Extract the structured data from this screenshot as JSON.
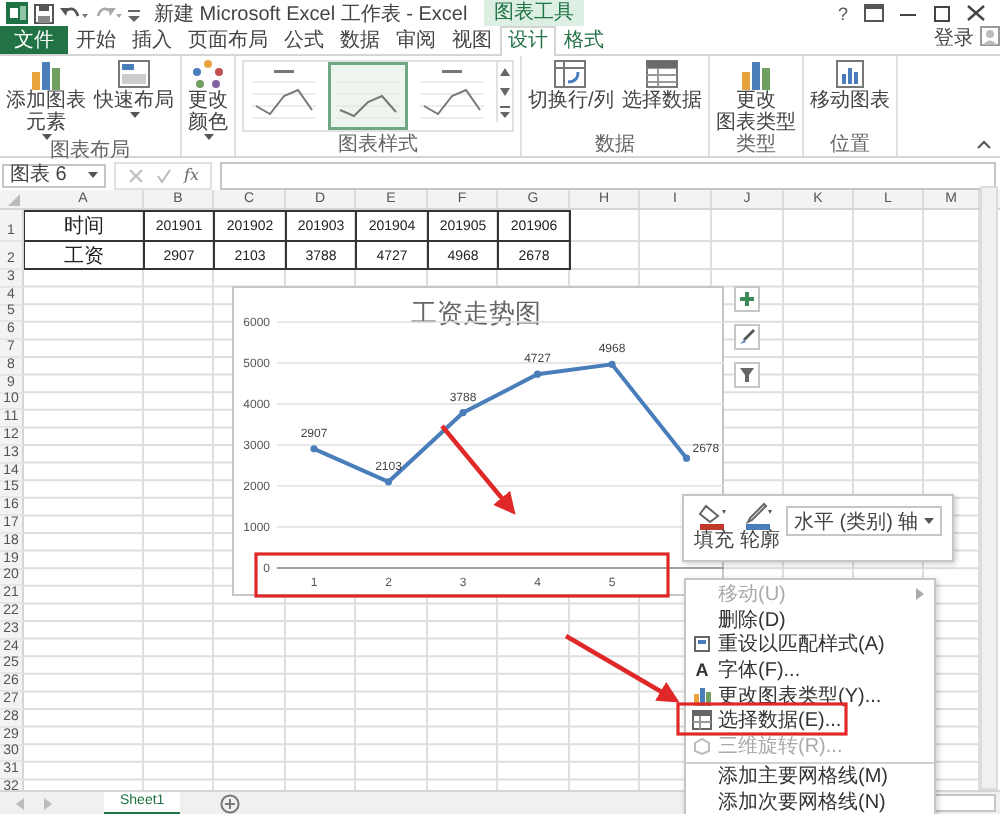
{
  "window": {
    "title": "新建 Microsoft Excel 工作表 - Excel",
    "context_tab_group": "图表工具",
    "help": "?",
    "sign_in": "登录"
  },
  "tabs": [
    {
      "label": "文件",
      "kind": "file",
      "selected": false
    },
    {
      "label": "开始",
      "kind": "tab",
      "selected": false
    },
    {
      "label": "插入",
      "kind": "tab",
      "selected": false
    },
    {
      "label": "页面布局",
      "kind": "tab",
      "selected": false
    },
    {
      "label": "公式",
      "kind": "tab",
      "selected": false
    },
    {
      "label": "数据",
      "kind": "tab",
      "selected": false
    },
    {
      "label": "审阅",
      "kind": "tab",
      "selected": false
    },
    {
      "label": "视图",
      "kind": "tab",
      "selected": false
    },
    {
      "label": "设计",
      "kind": "context",
      "selected": true
    },
    {
      "label": "格式",
      "kind": "context",
      "selected": false
    }
  ],
  "ribbon": {
    "groups": [
      {
        "label": "图表布局",
        "kind": "buttons",
        "buttons": [
          {
            "lines": [
              "添加图表",
              "元素"
            ],
            "dropdown": true
          },
          {
            "lines": [
              "快速布局"
            ],
            "dropdown": true
          }
        ]
      },
      {
        "kind": "buttons",
        "buttons": [
          {
            "lines": [
              "更改",
              "颜色"
            ],
            "dropdown": true
          }
        ]
      },
      {
        "label": "图表样式",
        "kind": "gallery",
        "styles": [
          {
            "selected": false
          },
          {
            "selected": true
          },
          {
            "selected": false
          }
        ]
      },
      {
        "label": "数据",
        "kind": "buttons",
        "buttons": [
          {
            "lines": [
              "切换行/列"
            ],
            "dropdown": false
          },
          {
            "lines": [
              "选择数据"
            ],
            "dropdown": false
          }
        ]
      },
      {
        "label": "类型",
        "kind": "buttons",
        "buttons": [
          {
            "lines": [
              "更改",
              "图表类型"
            ],
            "dropdown": false
          }
        ]
      },
      {
        "label": "位置",
        "kind": "buttons",
        "buttons": [
          {
            "lines": [
              "移动图表"
            ],
            "dropdown": false
          }
        ]
      }
    ]
  },
  "formula_bar": {
    "name_box": "图表 6",
    "fx": "fx"
  },
  "sheet": {
    "columns": [
      "A",
      "B",
      "C",
      "D",
      "E",
      "F",
      "G",
      "H",
      "I",
      "J",
      "K",
      "L",
      "M"
    ],
    "rows": [
      {
        "number": "1",
        "cells": [
          "时间",
          "201901",
          "201902",
          "201903",
          "201904",
          "201905",
          "201906"
        ]
      },
      {
        "number": "2",
        "cells": [
          "工资",
          "2907",
          "2103",
          "3788",
          "4727",
          "4968",
          "2678"
        ]
      },
      {
        "number": "3"
      },
      {
        "number": "4"
      },
      {
        "number": "5"
      },
      {
        "number": "6"
      },
      {
        "number": "7"
      },
      {
        "number": "8"
      },
      {
        "number": "9"
      },
      {
        "number": "10"
      },
      {
        "number": "11"
      },
      {
        "number": "12"
      },
      {
        "number": "13"
      },
      {
        "number": "14"
      },
      {
        "number": "15"
      },
      {
        "number": "16"
      },
      {
        "number": "17"
      },
      {
        "number": "18"
      },
      {
        "number": "19"
      },
      {
        "number": "20"
      },
      {
        "number": "21"
      },
      {
        "number": "22"
      },
      {
        "number": "23"
      },
      {
        "number": "24"
      },
      {
        "number": "25"
      },
      {
        "number": "26"
      },
      {
        "number": "27"
      },
      {
        "number": "28"
      },
      {
        "number": "29"
      },
      {
        "number": "30"
      },
      {
        "number": "31"
      },
      {
        "number": "32"
      }
    ]
  },
  "chart": {
    "chart_data": {
      "type": "line",
      "title": "工资走势图",
      "x": [
        1,
        2,
        3,
        4,
        5,
        6
      ],
      "series": [
        {
          "color": "#4a7ebb",
          "marker": true,
          "values": [
            2907,
            2103,
            3788,
            4727,
            4968,
            2678
          ]
        }
      ],
      "xlim": [
        0.5,
        6.5
      ],
      "ylim": [
        0,
        6000
      ],
      "grid": true,
      "yticks": [
        0,
        1000,
        2000,
        3000,
        4000,
        5000,
        6000
      ],
      "xticks": [
        1,
        2,
        3,
        4,
        5
      ],
      "data_labels": true
    }
  },
  "mini_toolbar": {
    "fill": "填充",
    "outline": "轮廓",
    "element": "水平 (类别) 轴"
  },
  "context_menu": [
    {
      "label": "移动(U)",
      "disabled": true,
      "submenu": true
    },
    {
      "label": "删除(D)",
      "disabled": false
    },
    {
      "label": "重设以匹配样式(A)",
      "disabled": false
    },
    {
      "label": "字体(F)...",
      "disabled": false,
      "glyph": "A"
    },
    {
      "label": "更改图表类型(Y)...",
      "disabled": false
    },
    {
      "label": "选择数据(E)...",
      "disabled": false
    },
    {
      "label": "三维旋转(R)...",
      "disabled": true
    },
    {
      "label": "添加主要网格线(M)",
      "disabled": false,
      "separator_before": true
    },
    {
      "label": "添加次要网格线(N)",
      "disabled": false
    }
  ],
  "sheet_tabs": [
    {
      "label": "Sheet1",
      "selected": true
    }
  ]
}
